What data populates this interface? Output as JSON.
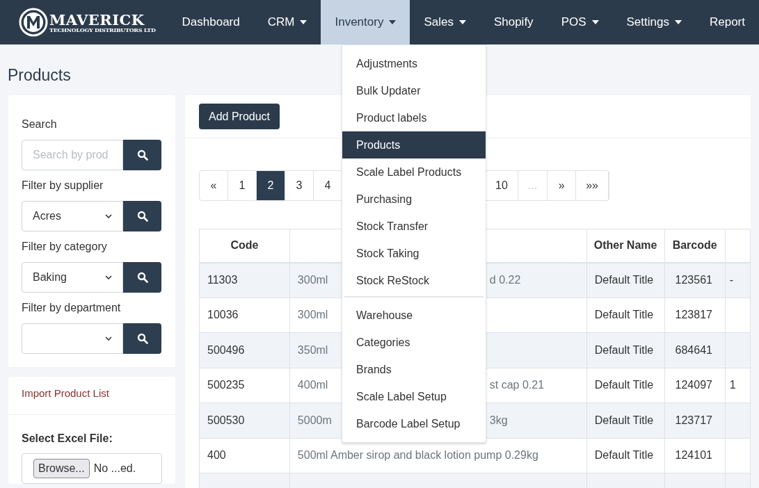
{
  "nav": {
    "logo_title": "MAVERICK",
    "logo_subtitle": "TECHNOLOGY DISTRIBUTORS LTD",
    "items": [
      {
        "label": "Dashboard",
        "dropdown": false,
        "selected": false
      },
      {
        "label": "CRM",
        "dropdown": true,
        "selected": false
      },
      {
        "label": "Inventory",
        "dropdown": true,
        "selected": true
      },
      {
        "label": "Sales",
        "dropdown": true,
        "selected": false
      },
      {
        "label": "Shopify",
        "dropdown": false,
        "selected": false
      },
      {
        "label": "POS",
        "dropdown": true,
        "selected": false
      },
      {
        "label": "Settings",
        "dropdown": true,
        "selected": false
      },
      {
        "label": "Report",
        "dropdown": false,
        "selected": false
      }
    ]
  },
  "menu": {
    "groups": [
      [
        {
          "label": "Adjustments",
          "selected": false
        },
        {
          "label": "Bulk Updater",
          "selected": false
        },
        {
          "label": "Product labels",
          "selected": false
        },
        {
          "label": "Products",
          "selected": true
        },
        {
          "label": "Scale Label Products",
          "selected": false
        },
        {
          "label": "Purchasing",
          "selected": false
        },
        {
          "label": "Stock Transfer",
          "selected": false
        },
        {
          "label": "Stock Taking",
          "selected": false
        },
        {
          "label": "Stock ReStock",
          "selected": false
        }
      ],
      [
        {
          "label": "Warehouse",
          "selected": false
        },
        {
          "label": "Categories",
          "selected": false
        },
        {
          "label": "Brands",
          "selected": false
        },
        {
          "label": "Scale Label Setup",
          "selected": false
        },
        {
          "label": "Barcode Label Setup",
          "selected": false
        }
      ]
    ]
  },
  "page_title": "Products",
  "filters": [
    {
      "label": "Search",
      "kind": "text",
      "placeholder": "Search by prod"
    },
    {
      "label": "Filter by supplier",
      "kind": "select",
      "value": "Acres"
    },
    {
      "label": "Filter by category",
      "kind": "select",
      "value": "Baking"
    },
    {
      "label": "Filter by department",
      "kind": "select"
    }
  ],
  "import": {
    "title": "Import Product List",
    "file_label": "Select Excel File:",
    "browse": "Browse...",
    "file_status": "No ...ed."
  },
  "add_button": "Add Product",
  "pagination": {
    "before": [
      {
        "label": "«",
        "selected": false
      },
      {
        "label": "1",
        "selected": false
      },
      {
        "label": "2",
        "selected": true
      },
      {
        "label": "3",
        "selected": false
      },
      {
        "label": "4",
        "selected": false
      }
    ],
    "after": [
      {
        "label": "10",
        "selected": false,
        "disabled": false
      },
      {
        "label": "...",
        "selected": false,
        "disabled": true
      },
      {
        "label": "»",
        "selected": false,
        "disabled": false
      },
      {
        "label": "»»",
        "selected": false,
        "disabled": false
      }
    ]
  },
  "table": {
    "columns": [
      "Code",
      "Other Name",
      "Barcode"
    ],
    "rows": [
      {
        "code": "11303",
        "name_start": "300ml",
        "name_end": "d 0.22",
        "other_name": "Default Title",
        "barcode": "123561",
        "column_5": "-"
      },
      {
        "code": "10036",
        "name_start": "300ml",
        "other_name": "Default Title",
        "barcode": "123817"
      },
      {
        "code": "500496",
        "name_start": "350ml",
        "other_name": "Default Title",
        "barcode": "684641"
      },
      {
        "code": "500235",
        "name_start": "400ml",
        "name_end": "st cap 0.21",
        "other_name": "Default Title",
        "barcode": "124097",
        "column_5": "1"
      },
      {
        "code": "500530",
        "name_start": "5000m",
        "name_end": "3kg",
        "other_name": "Default Title",
        "barcode": "123717"
      },
      {
        "code": "400",
        "name_start": "500ml Amber sirop and black lotion pump 0.29kg",
        "other_name": "Default Title",
        "barcode": "124101"
      }
    ]
  }
}
